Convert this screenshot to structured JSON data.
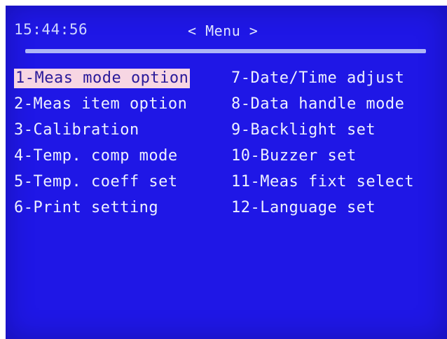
{
  "header": {
    "clock": "15:44:56",
    "title": "< Menu >"
  },
  "menu": {
    "selected_index": 0,
    "left_column": [
      "1-Meas mode option",
      "2-Meas item option",
      "3-Calibration",
      "4-Temp. comp mode",
      "5-Temp. coeff set",
      "6-Print setting"
    ],
    "right_column": [
      "7-Date/Time adjust",
      "8-Data handle mode",
      "9-Backlight set",
      "10-Buzzer set",
      "11-Meas fixt select",
      "12-Language set"
    ]
  },
  "colors": {
    "screen_background": "#1f17e6",
    "text": "#eef1ff",
    "selection_background": "#f7d6e3",
    "selection_text": "#2a1a9a",
    "divider": "#aeb6f6"
  }
}
